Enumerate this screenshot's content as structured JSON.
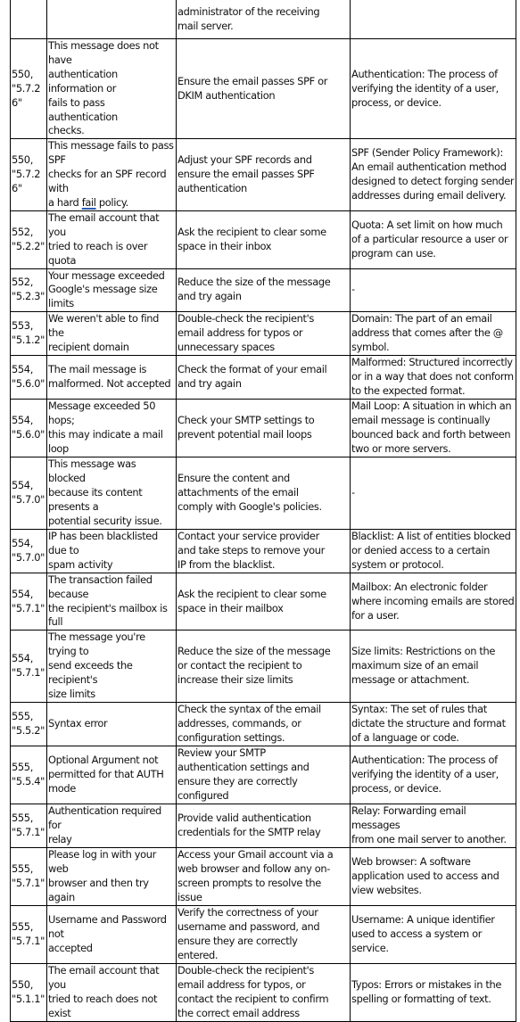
{
  "table": {
    "rows": [
      {
        "code": "",
        "description": "",
        "solution": "administrator of the receiving\nmail server.",
        "definition": "",
        "h": 44
      },
      {
        "code": "550,\n\"5.7.26\"",
        "description": "This message does not have\nauthentication information or\nfails to pass authentication\nchecks.",
        "solution": "Ensure the email passes SPF or\nDKIM authentication",
        "definition": "Authentication: The process of\nverifying the identity of a user,\nprocess, or device.",
        "h": 67
      },
      {
        "code": "550,\n\"5.7.26\"",
        "description_parts": [
          "This message fails to pass SPF\nchecks for an SPF record with\na hard ",
          "fail",
          " policy."
        ],
        "solution": "Adjust your SPF records and\nensure the email passes SPF\nauthentication",
        "definition": "SPF (Sender Policy Framework):\nAn email authentication method\ndesigned to detect forging sender\naddresses during email delivery.",
        "h": 65
      },
      {
        "code": "552,\n\"5.2.2\"",
        "description": "The email account that you\ntried to reach is over quota",
        "solution": "Ask the recipient to clear some\nspace in their inbox",
        "definition": "Quota: A set limit on how much\nof a particular resource a user or\nprogram can use.",
        "h": 48
      },
      {
        "code": "552,\n\"5.2.3\"",
        "description": "Your message exceeded\nGoogle's message size limits",
        "solution": "Reduce the size of the message\nand try again",
        "definition": "-",
        "h": 34
      },
      {
        "code": "553,\n\"5.1.2\"",
        "description": "We weren't able to find the\nrecipient domain",
        "solution": "Double-check the recipient's\nemail address for typos or\nunnecessary spaces",
        "definition": "Domain: The part of an email\naddress that comes after the @\nsymbol.",
        "h": 49
      },
      {
        "code": "554,\n\"5.6.0\"",
        "description": "The mail message is\nmalformed. Not accepted",
        "solution": "Check the format of your email\nand try again",
        "definition": "Malformed: Structured incorrectly\nor in a way that does not conform\nto the expected format.",
        "h": 49
      },
      {
        "code": "554,\n\"5.6.0\"",
        "description": "Message exceeded 50 hops;\nthis may indicate a mail loop",
        "solution": "Check your SMTP settings to\nprevent potential mail loops",
        "definition": "Mail Loop: A situation in which an\nemail message is continually\nbounced back and forth between\ntwo or more servers.",
        "h": 65
      },
      {
        "code": "554,\n\"5.7.0\"",
        "description": "This message was blocked\nbecause its content presents a\npotential security issue.",
        "solution": "Ensure the content and\nattachments of the email\ncomply with Google's policies.",
        "definition": "-",
        "h": 49
      },
      {
        "code": "554,\n\"5.7.0\"",
        "description": "IP has been blacklisted due to\nspam activity",
        "solution": "Contact your service provider\nand take steps to remove your\nIP from the blacklist.",
        "definition": "Blacklist: A list of entities blocked\nor denied access to a certain\nsystem or protocol.",
        "h": 49
      },
      {
        "code": "554,\n\"5.7.1\"",
        "description": "The transaction failed because\nthe recipient's mailbox is full",
        "solution": "Ask the recipient to clear some\nspace in their mailbox",
        "definition": "Mailbox: An electronic folder\nwhere incoming emails are stored\nfor a user.",
        "h": 49
      },
      {
        "code": "554,\n\"5.7.1\"",
        "description": "The message you're trying to\nsend exceeds the recipient's\nsize limits",
        "solution": "Reduce the size of the message\nor contact the recipient to\nincrease their size limits",
        "definition": "Size limits: Restrictions on the\nmaximum size of an email\nmessage or attachment.",
        "h": 49
      },
      {
        "code": "555,\n\"5.5.2\"",
        "description": "Syntax error",
        "solution": "Check the syntax of the email\naddresses, commands, or\nconfiguration settings.",
        "definition": "Syntax: The set of rules that\ndictate the structure and format\nof a language or code.",
        "h": 49
      },
      {
        "code": "555,\n\"5.5.4\"",
        "description": "Optional Argument not\npermitted for that AUTH\nmode",
        "solution": "Review your SMTP\nauthentication settings and\nensure they are correctly\nconfigured",
        "definition": "Authentication: The process of\nverifying the identity of a user,\nprocess, or device.",
        "h": 65
      },
      {
        "code": "555,\n\"5.7.1\"",
        "description": "Authentication required for\nrelay",
        "solution": "Provide valid authentication\ncredentials for the SMTP relay",
        "definition": "Relay: Forwarding email messages\nfrom one mail server to another.",
        "h": 34
      },
      {
        "code": "555,\n\"5.7.1\"",
        "description": "Please log in with your web\nbrowser and then try again",
        "solution": "Access your Gmail account via a\nweb browser and follow any on-\nscreen prompts to resolve the\nissue",
        "definition": "Web browser: A software\napplication used to access and\nview websites.",
        "h": 65
      },
      {
        "code": "555,\n\"5.7.1\"",
        "description": "Username and Password not\naccepted",
        "solution": "Verify the correctness of your\nusername and password, and\nensure they are correctly\nentered.",
        "definition": "Username: A unique identifier\nused to access a system or\nservice.",
        "h": 65
      },
      {
        "code": "550,\n\"5.1.1\"",
        "description": "The email account that you\ntried to reach does not exist",
        "solution": "Double-check the recipient's\nemail address for typos, or\ncontact the recipient to confirm\nthe correct email address",
        "definition": "Typos: Errors or mistakes in the\nspelling or formatting of text.",
        "h": 65
      }
    ]
  }
}
